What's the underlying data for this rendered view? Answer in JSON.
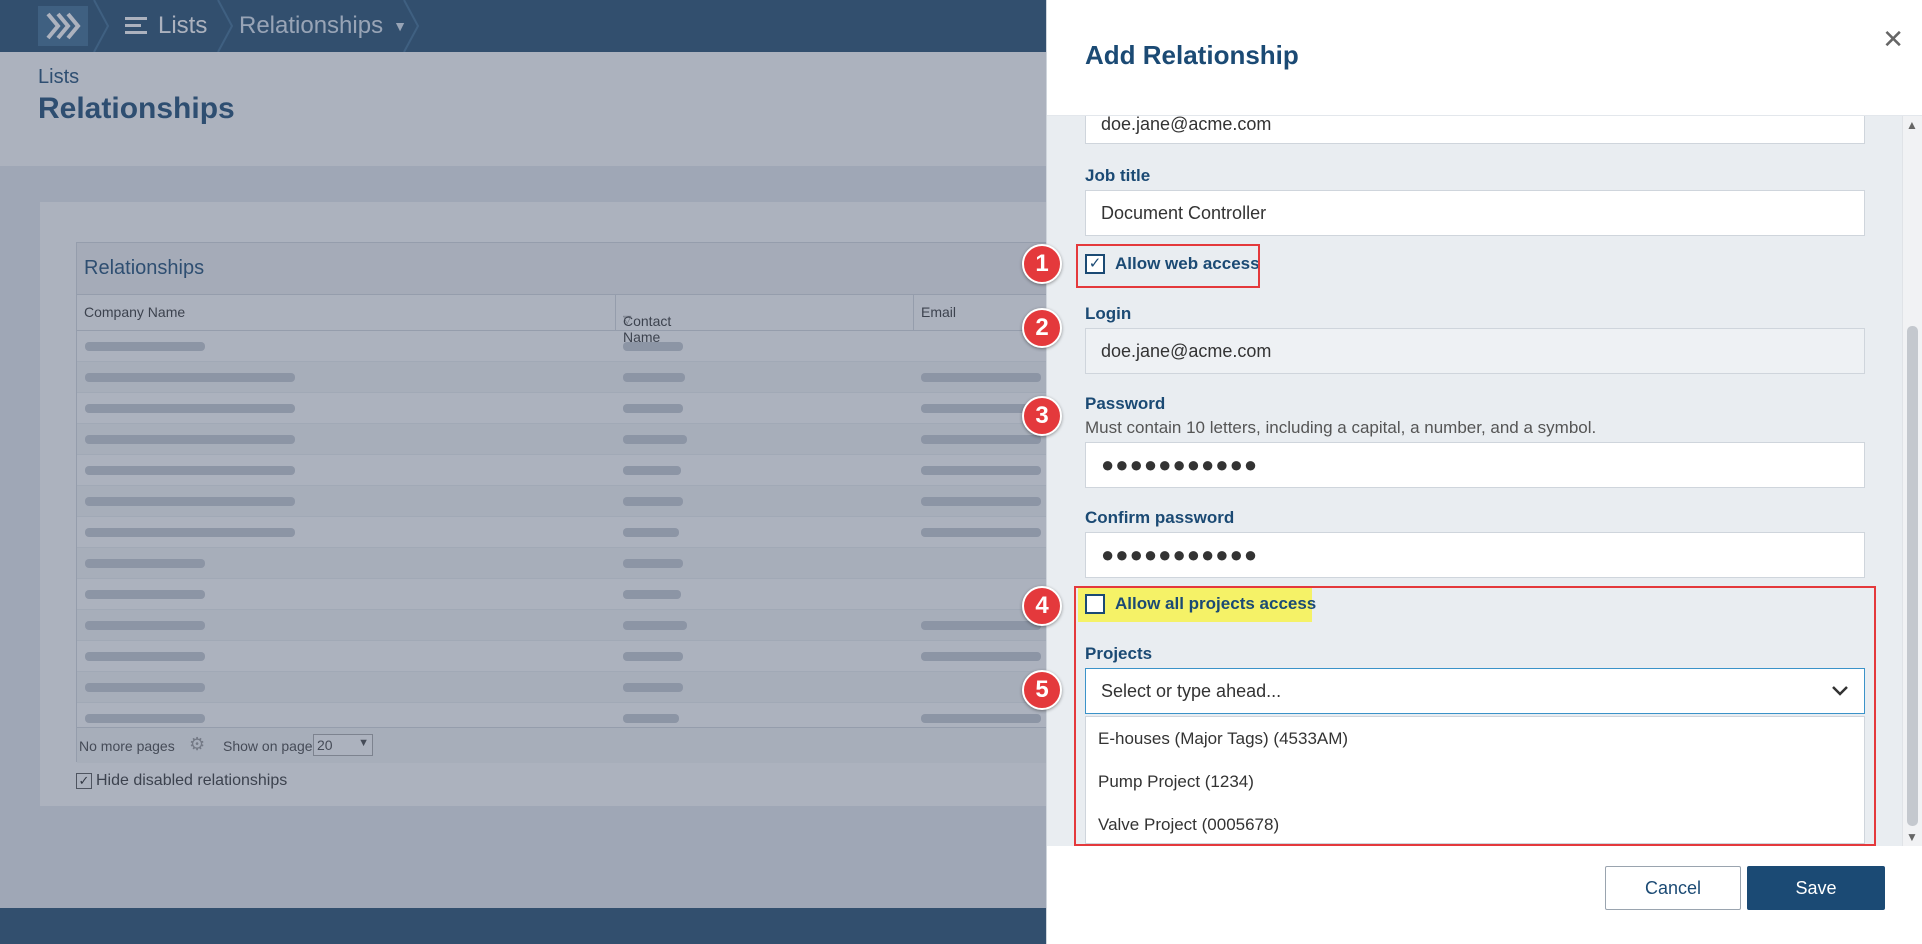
{
  "nav": {
    "items": [
      "Lists",
      "Relationships"
    ]
  },
  "page": {
    "subtitle": "Lists",
    "title": "Relationships"
  },
  "grid": {
    "caption": "Relationships",
    "columns": [
      "Company Name",
      "Contact Name",
      "Email"
    ],
    "pager_text": "No more pages",
    "show_on_page_label": "Show on page:",
    "page_size": "20",
    "hide_disabled_label": "Hide disabled relationships"
  },
  "modal": {
    "title": "Add Relationship",
    "email_value": "doe.jane@acme.com",
    "job_title_label": "Job title",
    "job_title_value": "Document Controller",
    "allow_web_label": "Allow web access",
    "login_label": "Login",
    "login_value": "doe.jane@acme.com",
    "password_label": "Password",
    "password_help": "Must contain 10 letters, including a capital, a number, and a symbol.",
    "password_value": "●●●●●●●●●●●",
    "confirm_label": "Confirm password",
    "confirm_value": "●●●●●●●●●●●",
    "allow_projects_label": "Allow all projects access",
    "projects_label": "Projects",
    "projects_placeholder": "Select or type ahead...",
    "project_options": [
      "E-houses (Major Tags) (4533AM)",
      "Pump Project (1234)",
      "Valve Project (0005678)"
    ],
    "cancel_label": "Cancel",
    "save_label": "Save"
  },
  "annotations": [
    "1",
    "2",
    "3",
    "4",
    "5"
  ],
  "colors": {
    "brand_dark": "#224b6e",
    "label_blue": "#1b4a74",
    "highlight_red": "#e4393c",
    "highlight_yellow": "#f5f267"
  }
}
